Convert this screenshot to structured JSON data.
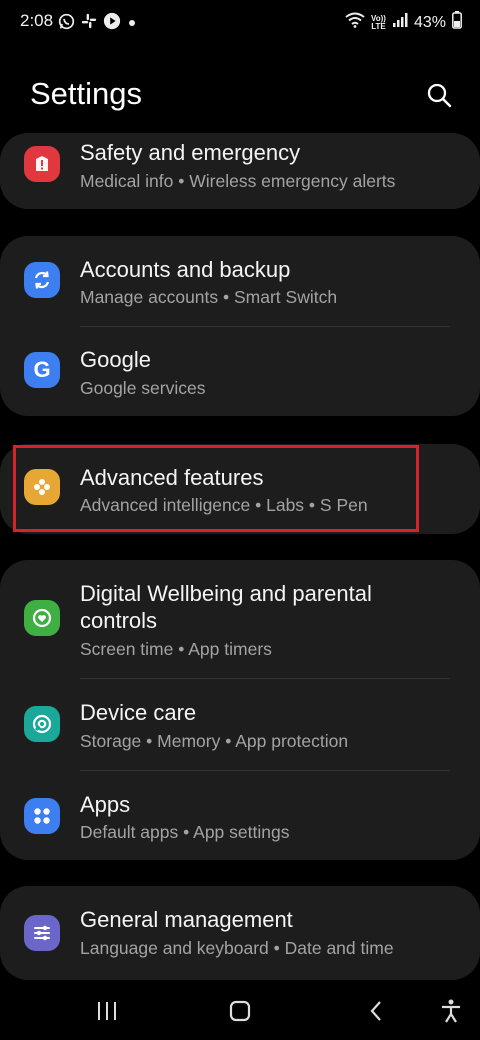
{
  "status_bar": {
    "time": "2:08",
    "battery": "43%",
    "network_top": "Vo))",
    "network_bottom": "LTE",
    "icons": [
      "whatsapp-icon",
      "slack-icon",
      "youtube-icon",
      "dot-icon",
      "wifi-icon",
      "signal-icon",
      "battery-icon"
    ]
  },
  "header": {
    "title": "Settings"
  },
  "items": [
    {
      "id": "safety",
      "title": "Safety and emergency",
      "subtitle": "Medical info  •  Wireless emergency alerts",
      "icon": "alert-icon",
      "color": "#e0383e"
    },
    {
      "id": "accounts",
      "title": "Accounts and backup",
      "subtitle": "Manage accounts  •  Smart Switch",
      "icon": "sync-icon",
      "color": "#3d7ef0"
    },
    {
      "id": "google",
      "title": "Google",
      "subtitle": "Google services",
      "icon": "google-icon",
      "color": "#3d7ef0"
    },
    {
      "id": "advanced",
      "title": "Advanced features",
      "subtitle": "Advanced intelligence  •  Labs  •  S Pen",
      "icon": "gear-flower-icon",
      "color": "#e6a734"
    },
    {
      "id": "wellbeing",
      "title_line1": "Digital Wellbeing and parental",
      "title_line2": "controls",
      "subtitle": "Screen time  •  App timers",
      "icon": "wellbeing-icon",
      "color": "#3fae43"
    },
    {
      "id": "devicecare",
      "title": "Device care",
      "subtitle": "Storage  •  Memory  •  App protection",
      "icon": "device-care-icon",
      "color": "#1aa89a"
    },
    {
      "id": "apps",
      "title": "Apps",
      "subtitle": "Default apps  •  App settings",
      "icon": "apps-icon",
      "color": "#3d7ef0"
    },
    {
      "id": "general",
      "title": "General management",
      "subtitle": "Language and keyboard  •  Date and time",
      "icon": "sliders-icon",
      "color": "#6b66c9"
    }
  ],
  "navbar": {
    "buttons": [
      "recents-icon",
      "home-icon",
      "back-icon",
      "accessibility-icon"
    ]
  }
}
